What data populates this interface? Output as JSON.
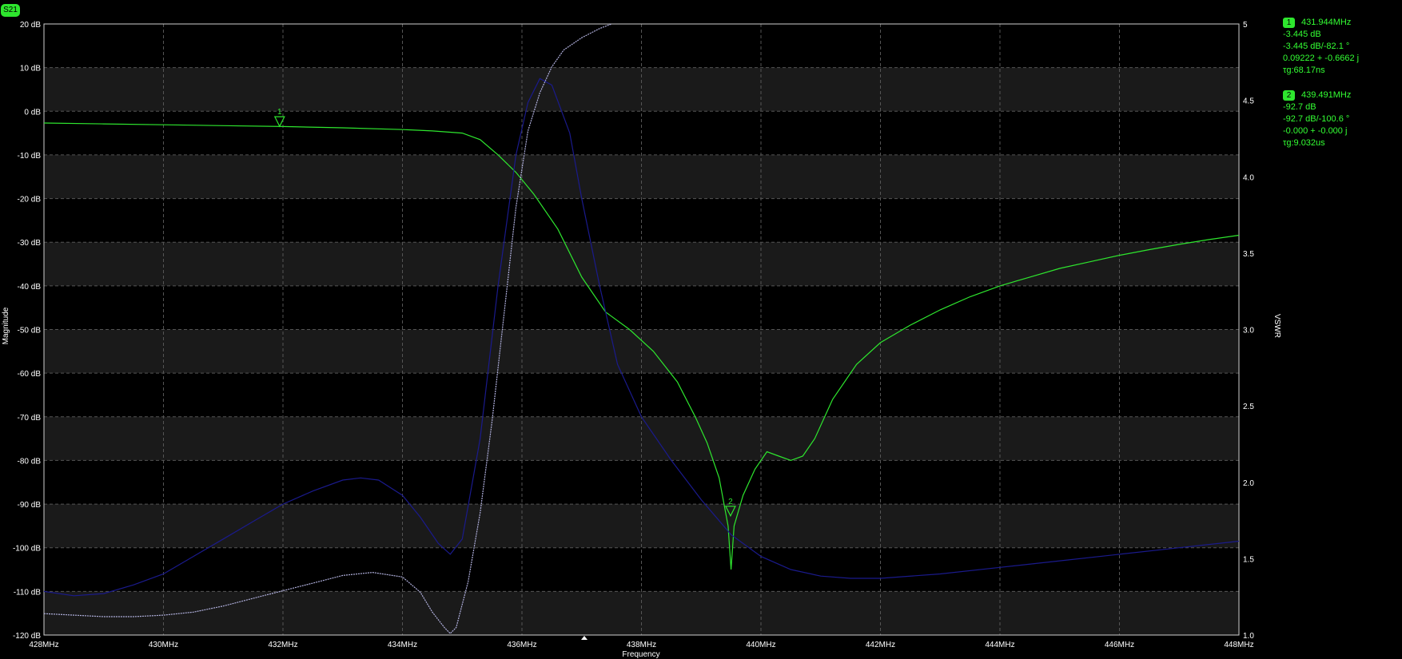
{
  "trace": {
    "label": "S21"
  },
  "markers": [
    {
      "id": "1",
      "freq": "431.944MHz",
      "lines": [
        "-3.445 dB",
        "-3.445 dB/-82.1 °",
        "0.09222 + -0.6662 j",
        "τg:68.17ns"
      ]
    },
    {
      "id": "2",
      "freq": "439.491MHz",
      "lines": [
        "-92.7 dB",
        "-92.7 dB/-100.6 °",
        "-0.000 + -0.000 j",
        "τg:9.032us"
      ]
    }
  ],
  "chart_data": {
    "type": "line",
    "xlabel": "Frequency",
    "ylabel": "Magnitude",
    "y2label": "VSWR",
    "xlim": [
      428,
      448
    ],
    "ylim": [
      -120,
      20
    ],
    "y2lim": [
      1.0,
      5.0
    ],
    "x_ticks": [
      "428MHz",
      "430MHz",
      "432MHz",
      "434MHz",
      "436MHz",
      "438MHz",
      "440MHz",
      "442MHz",
      "444MHz",
      "446MHz",
      "448MHz"
    ],
    "y_ticks": [
      "20 dB",
      "10 dB",
      "0 dB",
      "-10 dB",
      "-20 dB",
      "-30 dB",
      "-40 dB",
      "-50 dB",
      "-60 dB",
      "-70 dB",
      "-80 dB",
      "-90 dB",
      "-100 dB",
      "-110 dB",
      "-120 dB"
    ],
    "y2_ticks": [
      "5",
      "4.5",
      "4.0",
      "3.5",
      "3.0",
      "2.5",
      "2.0",
      "1.5",
      "1.0"
    ],
    "grid": true,
    "colors": {
      "s21": "#2ee62e",
      "s11": "#1a1a8c",
      "vswr": "#b0b0dd",
      "grid": "#555555"
    },
    "series": [
      {
        "key": "s21",
        "axis": "y",
        "x": [
          428,
          429,
          430,
          431,
          432,
          433,
          434,
          434.5,
          435,
          435.3,
          435.6,
          435.9,
          436.2,
          436.6,
          437,
          437.4,
          437.8,
          438.2,
          438.6,
          438.9,
          439.1,
          439.3,
          439.45,
          439.5,
          439.55,
          439.7,
          439.9,
          440.1,
          440.3,
          440.5,
          440.7,
          440.9,
          441.2,
          441.6,
          442,
          442.5,
          443,
          443.5,
          444,
          444.5,
          445,
          445.5,
          446,
          446.5,
          447,
          447.5,
          448
        ],
        "y": [
          -2.7,
          -2.9,
          -3.1,
          -3.3,
          -3.5,
          -3.8,
          -4.2,
          -4.5,
          -5,
          -6.5,
          -10,
          -14,
          -19,
          -27,
          -38,
          -46,
          -50,
          -55,
          -62,
          -70,
          -76,
          -84,
          -95,
          -105,
          -95,
          -88,
          -82,
          -78,
          -79,
          -80,
          -79,
          -75,
          -66,
          -58,
          -53,
          -49,
          -45.5,
          -42.5,
          -40,
          -38,
          -36,
          -34.5,
          -33,
          -31.7,
          -30.5,
          -29.4,
          -28.4
        ]
      },
      {
        "key": "s11",
        "axis": "y",
        "x": [
          428,
          428.5,
          429,
          429.5,
          430,
          430.5,
          431,
          431.5,
          432,
          432.5,
          433,
          433.3,
          433.6,
          434,
          434.3,
          434.6,
          434.8,
          435,
          435.3,
          435.6,
          435.9,
          436.1,
          436.3,
          436.5,
          436.8,
          437,
          437.3,
          437.6,
          438,
          438.5,
          439,
          439.5,
          440,
          440.5,
          441,
          441.5,
          442,
          443,
          444,
          445,
          446,
          447,
          448
        ],
        "y": [
          -110,
          -111,
          -110.5,
          -108.5,
          -106,
          -102,
          -98,
          -94,
          -90,
          -87,
          -84.5,
          -84,
          -84.5,
          -88,
          -93,
          -99,
          -101.5,
          -98,
          -75,
          -40,
          -10,
          2,
          7.5,
          6,
          -5,
          -20,
          -40,
          -58,
          -70,
          -80,
          -89,
          -97,
          -102,
          -105,
          -106.5,
          -107,
          -107,
          -106,
          -104.5,
          -103,
          -101.5,
          -100,
          -98.5
        ]
      },
      {
        "key": "vswr",
        "axis": "y2",
        "x": [
          428,
          428.5,
          429,
          429.5,
          430,
          430.5,
          431,
          431.5,
          432,
          432.5,
          433,
          433.5,
          434,
          434.3,
          434.5,
          434.7,
          434.8,
          434.9,
          435.1,
          435.3,
          435.5,
          435.7,
          435.9,
          436.1,
          436.3,
          436.5,
          436.7,
          437,
          437.3,
          437.5
        ],
        "y": [
          1.14,
          1.13,
          1.12,
          1.12,
          1.13,
          1.15,
          1.19,
          1.24,
          1.29,
          1.34,
          1.39,
          1.41,
          1.38,
          1.28,
          1.15,
          1.05,
          1.01,
          1.05,
          1.35,
          1.8,
          2.4,
          3.1,
          3.8,
          4.3,
          4.55,
          4.72,
          4.83,
          4.91,
          4.97,
          5.0
        ]
      }
    ],
    "markers": [
      {
        "label": "1",
        "x": 431.944,
        "y": -3.445
      },
      {
        "label": "2",
        "x": 439.491,
        "y": -92.7
      }
    ]
  }
}
